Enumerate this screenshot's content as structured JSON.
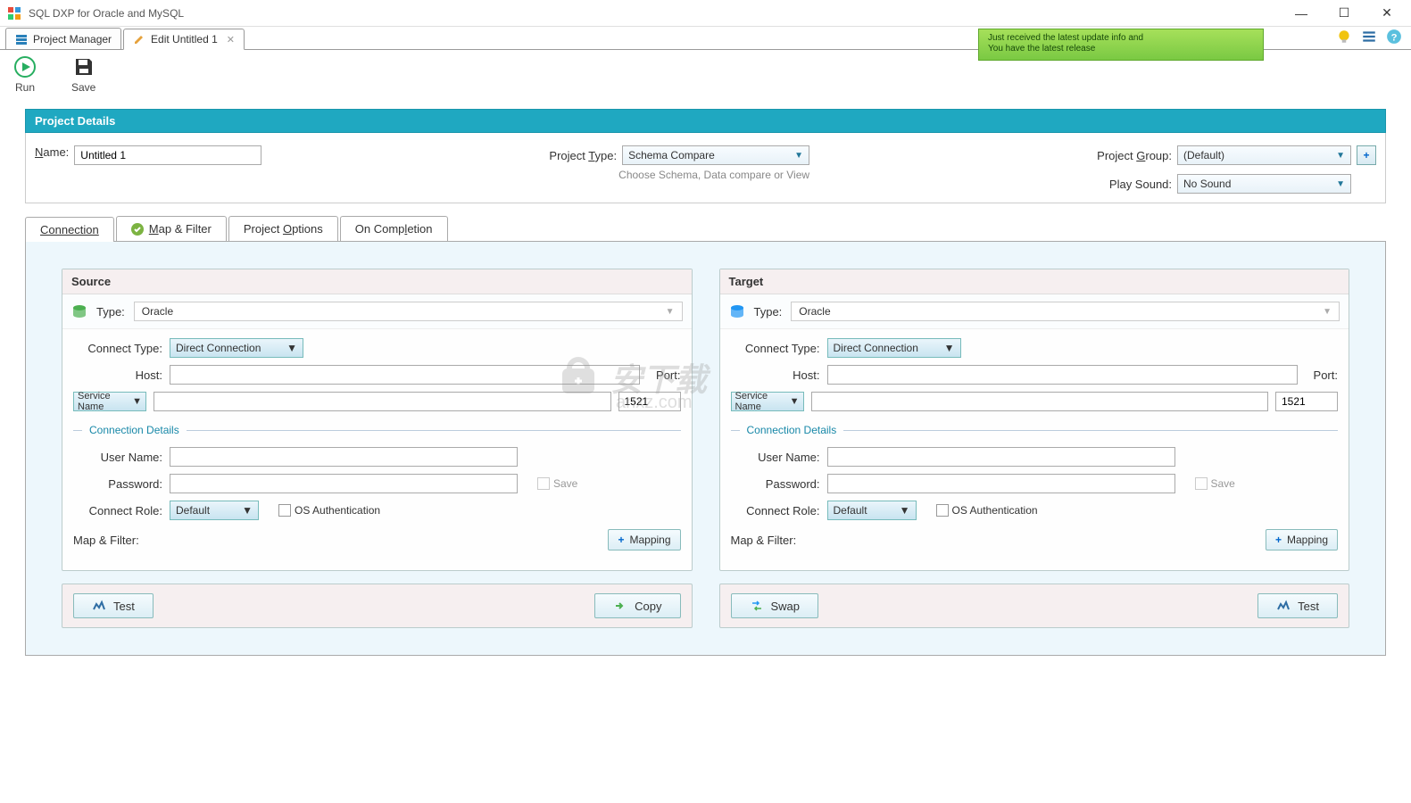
{
  "window": {
    "title": "SQL DXP for Oracle and MySQL"
  },
  "tabs": [
    {
      "label": "Project Manager",
      "active": false
    },
    {
      "label": "Edit Untitled 1",
      "active": true
    }
  ],
  "toolbar": {
    "run": "Run",
    "save": "Save"
  },
  "notification": {
    "line1": "Just received the latest update info and",
    "line2": "You have the latest release"
  },
  "project_details": {
    "header": "Project Details",
    "name_label": "Name:",
    "name_value": "Untitled 1",
    "type_label": "Project Type:",
    "type_value": "Schema Compare",
    "type_hint": "Choose Schema, Data compare or View",
    "group_label": "Project Group:",
    "group_value": "(Default)",
    "sound_label": "Play Sound:",
    "sound_value": "No Sound"
  },
  "inner_tabs": {
    "connection": "Connection",
    "map_filter": "Map & Filter",
    "options": "Project Options",
    "completion": "On Completion"
  },
  "conn": {
    "source_title": "Source",
    "target_title": "Target",
    "type_label": "Type:",
    "type_value": "Oracle",
    "connect_type_label": "Connect Type:",
    "connect_type_value": "Direct Connection",
    "host_label": "Host:",
    "port_label": "Port:",
    "port_value": "1521",
    "service_name": "Service Name",
    "details_label": "Connection Details",
    "user_label": "User Name:",
    "pass_label": "Password:",
    "save_label": "Save",
    "role_label": "Connect Role:",
    "role_value": "Default",
    "osauth_label": "OS Authentication",
    "mapfilter_label": "Map & Filter:",
    "mapping_btn": "Mapping",
    "test_btn": "Test",
    "copy_btn": "Copy",
    "swap_btn": "Swap"
  },
  "watermark": "anxz.com"
}
